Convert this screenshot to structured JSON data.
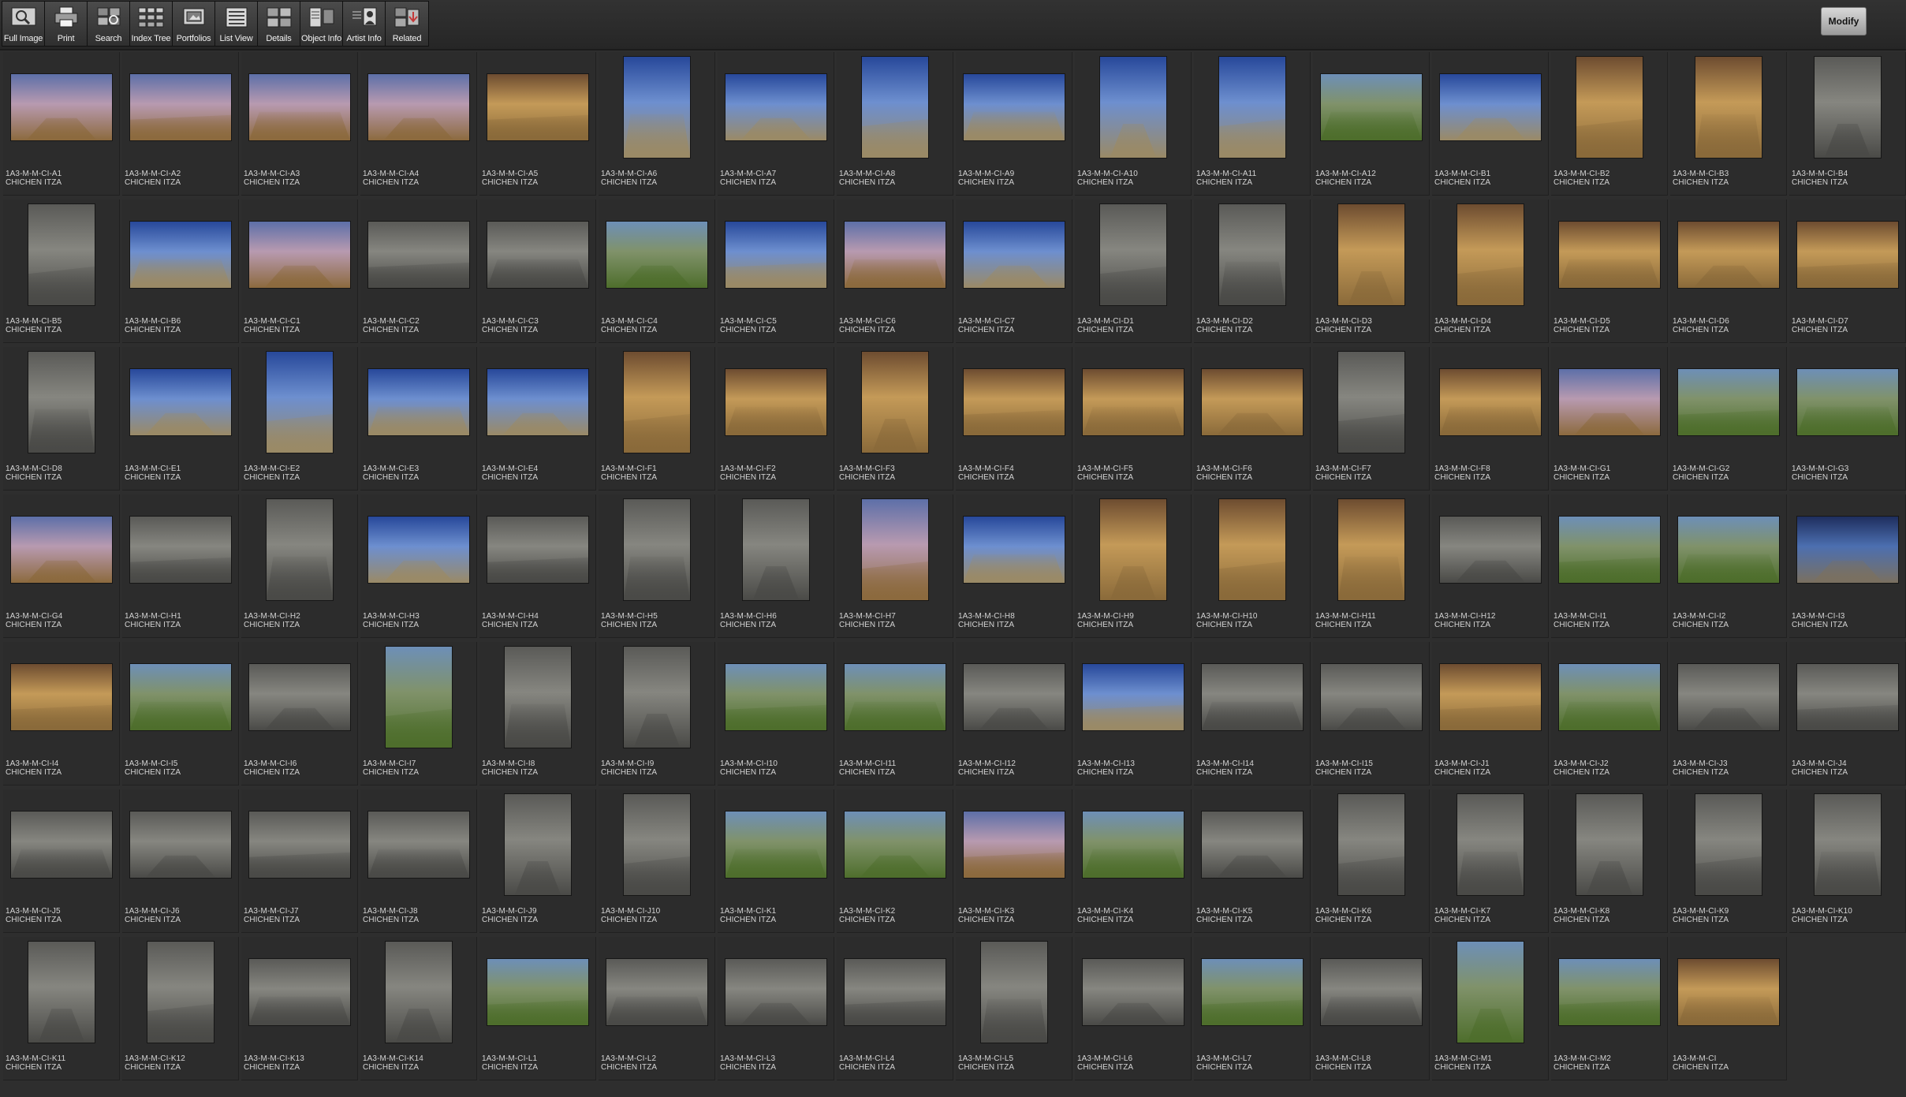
{
  "toolbar": {
    "buttons": [
      {
        "label": "Full Image",
        "icon": "full-image-icon"
      },
      {
        "label": "Print",
        "icon": "printer-icon"
      },
      {
        "label": "Search",
        "icon": "search-icon"
      },
      {
        "label": "Index Tree",
        "icon": "index-tree-icon"
      },
      {
        "label": "Portfolios",
        "icon": "portfolio-icon"
      },
      {
        "label": "List View",
        "icon": "list-view-icon"
      },
      {
        "label": "Details",
        "icon": "details-icon"
      },
      {
        "label": "Object Info",
        "icon": "object-info-icon"
      },
      {
        "label": "Artist  Info",
        "icon": "artist-info-icon"
      },
      {
        "label": "Related",
        "icon": "related-icon"
      }
    ],
    "modify_label": "Modify"
  },
  "site_name": "CHICHEN ITZA",
  "items": [
    "1A3-M-M-CI-A1",
    "1A3-M-M-CI-A2",
    "1A3-M-M-CI-A3",
    "1A3-M-M-CI-A4",
    "1A3-M-M-CI-A5",
    "1A3-M-M-CI-A6",
    "1A3-M-M-CI-A7",
    "1A3-M-M-CI-A8",
    "1A3-M-M-CI-A9",
    "1A3-M-M-CI-A10",
    "1A3-M-M-CI-A11",
    "1A3-M-M-CI-A12",
    "1A3-M-M-CI-B1",
    "1A3-M-M-CI-B2",
    "1A3-M-M-CI-B3",
    "1A3-M-M-CI-B4",
    "1A3-M-M-CI-B5",
    "1A3-M-M-CI-B6",
    "1A3-M-M-CI-C1",
    "1A3-M-M-CI-C2",
    "1A3-M-M-CI-C3",
    "1A3-M-M-CI-C4",
    "1A3-M-M-CI-C5",
    "1A3-M-M-CI-C6",
    "1A3-M-M-CI-C7",
    "1A3-M-M-CI-D1",
    "1A3-M-M-CI-D2",
    "1A3-M-M-CI-D3",
    "1A3-M-M-CI-D4",
    "1A3-M-M-CI-D5",
    "1A3-M-M-CI-D6",
    "1A3-M-M-CI-D7",
    "1A3-M-M-CI-D8",
    "1A3-M-M-CI-E1",
    "1A3-M-M-CI-E2",
    "1A3-M-M-CI-E3",
    "1A3-M-M-CI-E4",
    "1A3-M-M-CI-F1",
    "1A3-M-M-CI-F2",
    "1A3-M-M-CI-F3",
    "1A3-M-M-CI-F4",
    "1A3-M-M-CI-F5",
    "1A3-M-M-CI-F6",
    "1A3-M-M-CI-F7",
    "1A3-M-M-CI-F8",
    "1A3-M-M-CI-G1",
    "1A3-M-M-CI-G2",
    "1A3-M-M-CI-G3",
    "1A3-M-M-CI-G4",
    "1A3-M-M-CI-H1",
    "1A3-M-M-CI-H2",
    "1A3-M-M-CI-H3",
    "1A3-M-M-CI-H4",
    "1A3-M-M-CI-H5",
    "1A3-M-M-CI-H6",
    "1A3-M-M-CI-H7",
    "1A3-M-M-CI-H8",
    "1A3-M-M-CI-H9",
    "1A3-M-M-CI-H10",
    "1A3-M-M-CI-H11",
    "1A3-M-M-CI-H12",
    "1A3-M-M-CI-I1",
    "1A3-M-M-CI-I2",
    "1A3-M-M-CI-I3",
    "1A3-M-M-CI-I4",
    "1A3-M-M-CI-I5",
    "1A3-M-M-CI-I6",
    "1A3-M-M-CI-I7",
    "1A3-M-M-CI-I8",
    "1A3-M-M-CI-I9",
    "1A3-M-M-CI-I10",
    "1A3-M-M-CI-I11",
    "1A3-M-M-CI-I12",
    "1A3-M-M-CI-I13",
    "1A3-M-M-CI-I14",
    "1A3-M-M-CI-I15",
    "1A3-M-M-CI-J1",
    "1A3-M-M-CI-J2",
    "1A3-M-M-CI-J3",
    "1A3-M-M-CI-J4",
    "1A3-M-M-CI-J5",
    "1A3-M-M-CI-J6",
    "1A3-M-M-CI-J7",
    "1A3-M-M-CI-J8",
    "1A3-M-M-CI-J9",
    "1A3-M-M-CI-J10",
    "1A3-M-M-CI-K1",
    "1A3-M-M-CI-K2",
    "1A3-M-M-CI-K3",
    "1A3-M-M-CI-K4",
    "1A3-M-M-CI-K5",
    "1A3-M-M-CI-K6",
    "1A3-M-M-CI-K7",
    "1A3-M-M-CI-K8",
    "1A3-M-M-CI-K9",
    "1A3-M-M-CI-K10",
    "1A3-M-M-CI-K11",
    "1A3-M-M-CI-K12",
    "1A3-M-M-CI-K13",
    "1A3-M-M-CI-K14",
    "1A3-M-M-CI-L1",
    "1A3-M-M-CI-L2",
    "1A3-M-M-CI-L3",
    "1A3-M-M-CI-L4",
    "1A3-M-M-CI-L5",
    "1A3-M-M-CI-L6",
    "1A3-M-M-CI-L7",
    "1A3-M-M-CI-L8",
    "1A3-M-M-CI-M1",
    "1A3-M-M-CI-M2",
    "1A3-M-M-CI"
  ],
  "colors": {
    "background": "#2e2e2e",
    "cell": "#2c2c2c",
    "label_text": "#d4d4d4",
    "sky_blue": "#3f5fa8",
    "dusk_purple": "#7a6a9a",
    "stone_tan": "#b89a63",
    "stone_grey": "#6e6e6a",
    "grass_green": "#5f7d3a"
  }
}
